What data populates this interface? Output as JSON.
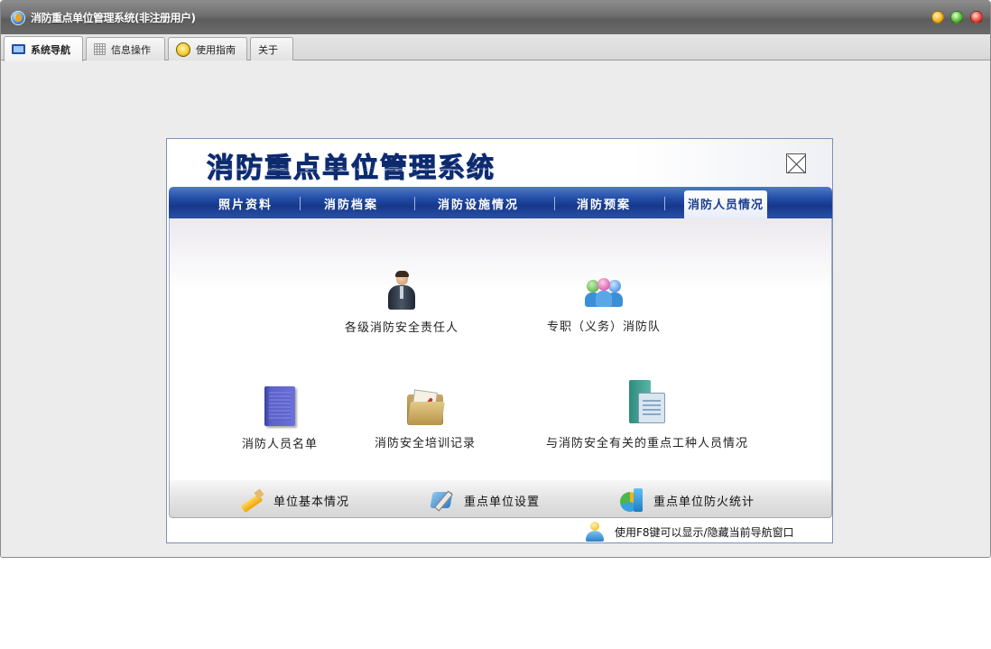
{
  "window": {
    "title": "消防重点单位管理系统(非注册用户)"
  },
  "tabs": [
    {
      "label": "系统导航",
      "icon": "monitor-icon",
      "active": true
    },
    {
      "label": "信息操作",
      "icon": "grid-icon",
      "active": false
    },
    {
      "label": "使用指南",
      "icon": "guide-icon",
      "active": false
    },
    {
      "label": "关于",
      "icon": "",
      "active": false
    }
  ],
  "panel": {
    "logo": "消防重点单位管理系统",
    "nav": [
      {
        "label": "照片资料",
        "active": false
      },
      {
        "label": "消防档案",
        "active": false
      },
      {
        "label": "消防设施情况",
        "active": false
      },
      {
        "label": "消防预案",
        "active": false
      },
      {
        "label": "消防人员情况",
        "active": true
      }
    ],
    "items": [
      {
        "label": "各级消防安全责任人",
        "icon": "person-icon"
      },
      {
        "label": "专职（义务）消防队",
        "icon": "group-icon"
      },
      {
        "label": "消防人员名单",
        "icon": "book-icon"
      },
      {
        "label": "消防安全培训记录",
        "icon": "folder-icon"
      },
      {
        "label": "与消防安全有关的重点工种人员情况",
        "icon": "document-icon"
      }
    ],
    "bottom": [
      {
        "label": "单位基本情况",
        "icon": "pencil-icon"
      },
      {
        "label": "重点单位设置",
        "icon": "tools-icon"
      },
      {
        "label": "重点单位防火统计",
        "icon": "chart-icon"
      }
    ],
    "hint": "使用F8键可以显示/隐藏当前导航窗口"
  },
  "colors": {
    "nav_bar": "#1f4aa3",
    "logo_text": "#1e3f8f",
    "title_bar": "#6e6e6e"
  }
}
